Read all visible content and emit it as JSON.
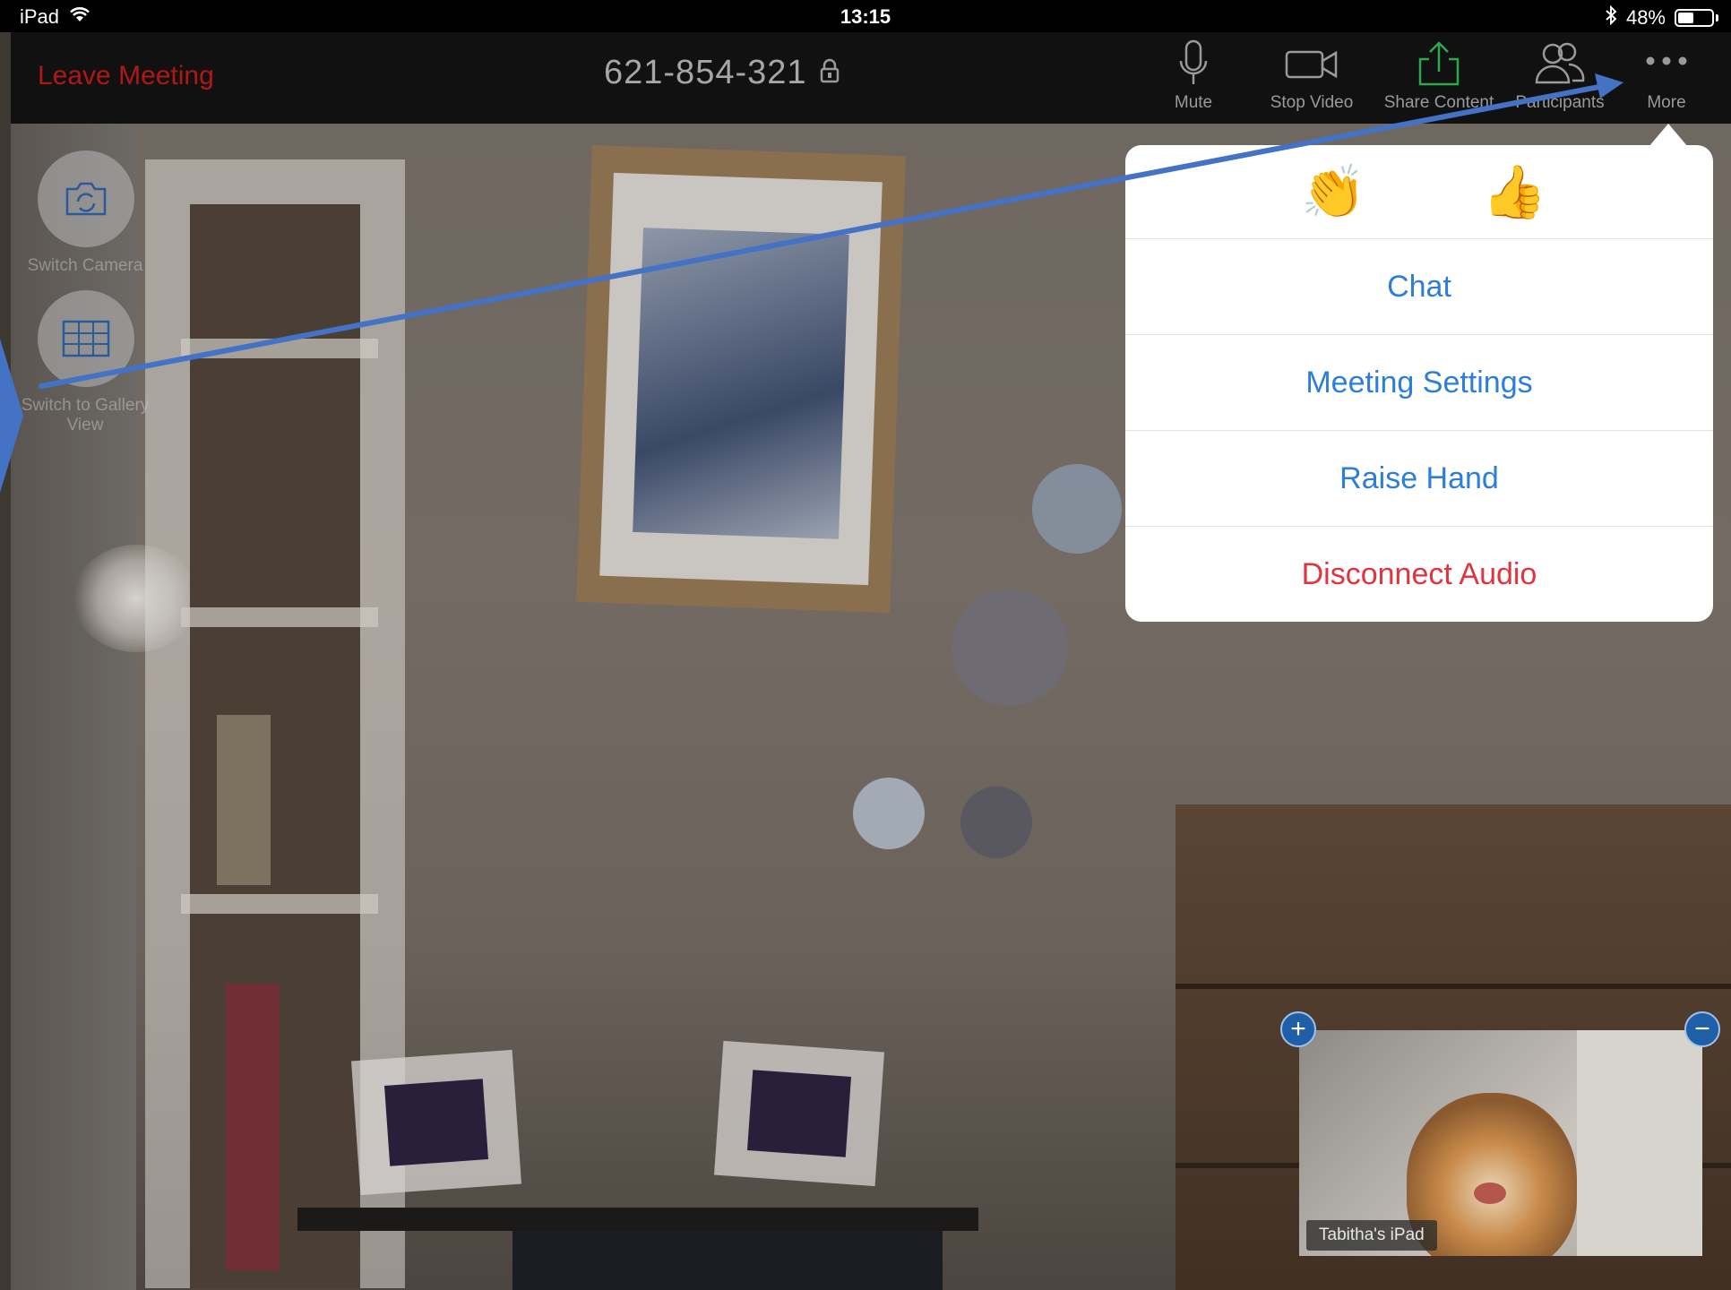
{
  "status_bar": {
    "device": "iPad",
    "time": "13:15",
    "battery_text": "48%",
    "battery_level": 0.48
  },
  "toolbar": {
    "leave_label": "Leave Meeting",
    "meeting_id": "621-854-321",
    "tools": {
      "mute": "Mute",
      "stop_video": "Stop Video",
      "share_content": "Share Content",
      "participants": "Participants",
      "more": "More"
    }
  },
  "side_controls": {
    "switch_camera": "Switch Camera",
    "gallery_view": "Switch to Gallery View"
  },
  "more_menu": {
    "reactions": [
      "👏",
      "👍"
    ],
    "items": {
      "chat": "Chat",
      "meeting_settings": "Meeting Settings",
      "raise_hand": "Raise Hand",
      "disconnect_audio": "Disconnect Audio"
    }
  },
  "self_view": {
    "name": "Tabitha's iPad",
    "zoom_in": "+",
    "zoom_out": "−"
  },
  "colors": {
    "leave": "#b01818",
    "menu_link": "#2d7ddc",
    "danger": "#e0343e",
    "share_icon": "#2ea84a",
    "annotation": "#4472c4"
  }
}
